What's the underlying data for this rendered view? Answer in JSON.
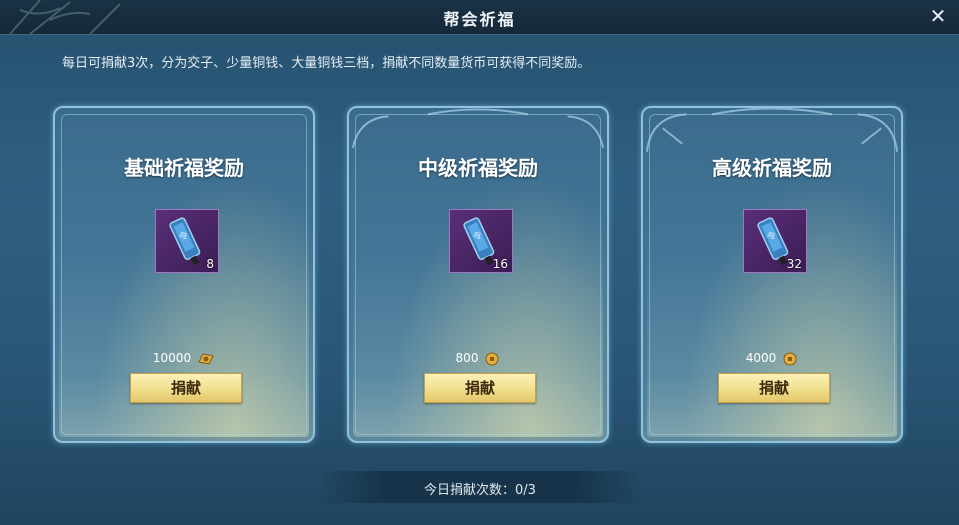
{
  "window": {
    "title": "帮会祈福",
    "description": "每日可捐献3次，分为交子、少量铜钱、大量铜钱三档，捐献不同数量货币可获得不同奖励。"
  },
  "cards": [
    {
      "title": "基础祈福奖励",
      "item_count": "8",
      "cost": "10000",
      "currency_icon": "jiaozi-coin-icon",
      "button_label": "捐献"
    },
    {
      "title": "中级祈福奖励",
      "item_count": "16",
      "cost": "800",
      "currency_icon": "copper-coin-icon",
      "button_label": "捐献"
    },
    {
      "title": "高级祈福奖励",
      "item_count": "32",
      "cost": "4000",
      "currency_icon": "copper-coin-icon",
      "button_label": "捐献"
    }
  ],
  "footer": {
    "donation_count": "今日捐献次数：0/3"
  },
  "colors": {
    "accent_button": "#efdc88",
    "item_frame": "#5a2f78",
    "card_border": "#8fc2dc"
  }
}
